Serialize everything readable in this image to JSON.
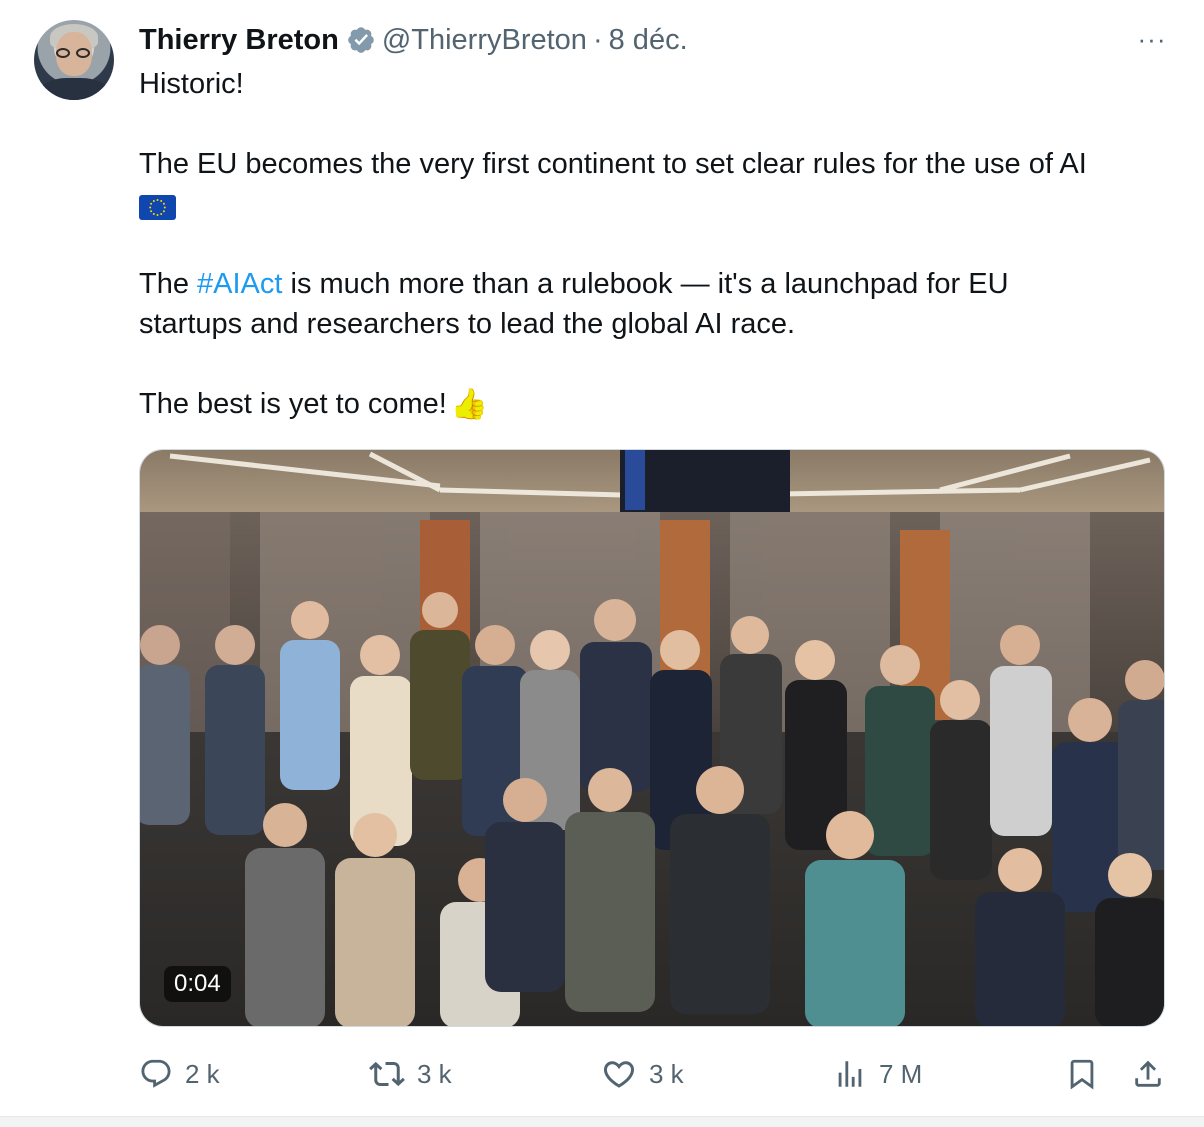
{
  "tweet": {
    "author_name": "Thierry Breton",
    "author_handle": "@ThierryBreton",
    "separator": "·",
    "date": "8 déc.",
    "more_label": "···",
    "lines": {
      "l1": "Historic!",
      "l2": "The EU becomes the very first continent to set clear rules for the use of AI",
      "l3_pre": "The ",
      "l3_hashtag": "#AIAct",
      "l3_post": " is much more than a rulebook — it's a launchpad for EU",
      "l4": "startups and researchers to lead the global AI race.",
      "l5": "The best is yet to come!"
    },
    "emoji": {
      "flag": "eu-flag-icon",
      "thumbs_up": "👍"
    },
    "media": {
      "type": "video",
      "duration": "0:04"
    },
    "actions": {
      "replies": "2 k",
      "reposts": "3 k",
      "likes": "3 k",
      "views": "7 M"
    }
  },
  "colors": {
    "text": "#0f1419",
    "secondary": "#536471",
    "link": "#1d9bf0",
    "verified": "#829aab"
  }
}
